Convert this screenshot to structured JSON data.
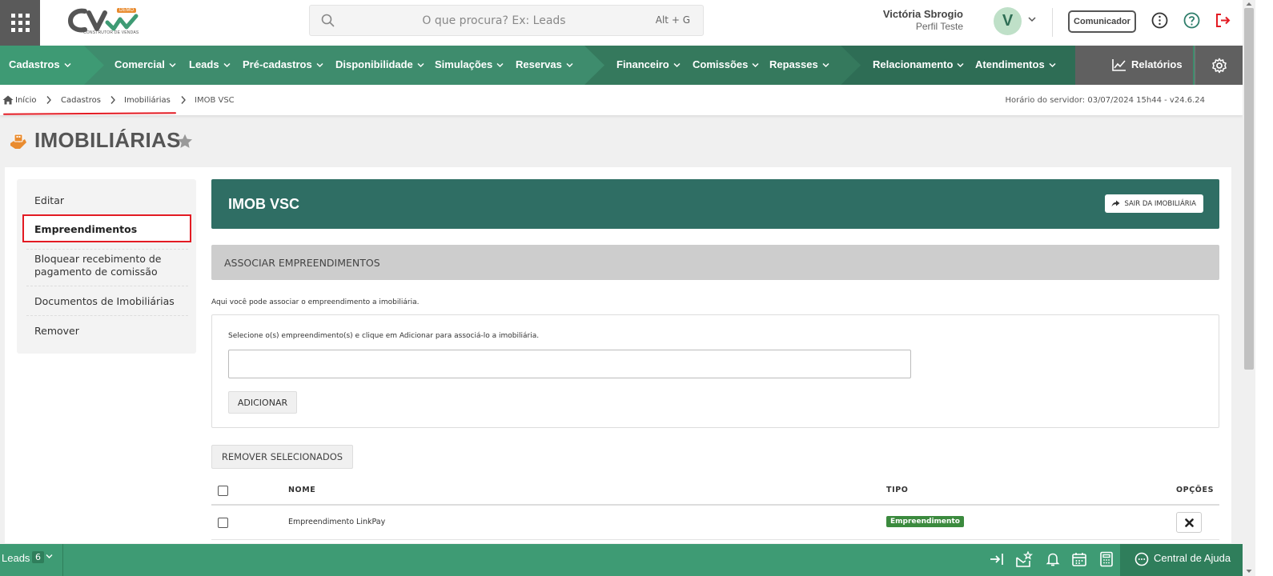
{
  "header": {
    "logo_text": "CV",
    "logo_badge": "DEMO",
    "logo_tagline": "CONSTRUTOR DE VENDAS",
    "search_placeholder": "O que procura? Ex: Leads",
    "search_shortcut": "Alt + G",
    "user_name": "Victória Sbrogio",
    "user_profile": "Perfil Teste",
    "avatar_letter": "V",
    "comunicador_label": "Comunicador",
    "icons": [
      "apps-grid-icon",
      "search-icon",
      "chevron-down-icon",
      "info-icon",
      "help-icon",
      "logout-icon"
    ]
  },
  "nav": {
    "items": [
      {
        "label": "Cadastros"
      },
      {
        "label": "Comercial"
      },
      {
        "label": "Leads"
      },
      {
        "label": "Pré-cadastros"
      },
      {
        "label": "Disponibilidade"
      },
      {
        "label": "Simulações"
      },
      {
        "label": "Reservas"
      },
      {
        "label": "Financeiro"
      },
      {
        "label": "Comissões"
      },
      {
        "label": "Repasses"
      },
      {
        "label": "Relacionamento"
      },
      {
        "label": "Atendimentos"
      }
    ],
    "relatorios_label": "Relatórios",
    "colors": {
      "base": "#3e8c6d",
      "seg_light": "#4aa07e",
      "seg_mid": "#3a8063",
      "seg_dark": "#2e6d55",
      "gray": "#606060"
    }
  },
  "breadcrumb": {
    "items": [
      "Início",
      "Cadastros",
      "Imobiliárias",
      "IMOB VSC"
    ],
    "server_time": "Horário do servidor: 03/07/2024 15h44 - v24.6.24"
  },
  "page": {
    "title": "IMOBILIÁRIAS"
  },
  "sidemenu": {
    "items": [
      {
        "label": "Editar"
      },
      {
        "label": "Empreendimentos"
      },
      {
        "label": "Bloquear recebimento de"
      },
      {
        "label": "pagamento de comissão"
      },
      {
        "label": "Documentos de Imobiliárias"
      },
      {
        "label": "Remover"
      }
    ]
  },
  "main": {
    "imob_name": "IMOB VSC",
    "sair_label": "SAIR DA IMOBILIÁRIA",
    "assoc_title": "ASSOCIAR EMPREENDIMENTOS",
    "assoc_desc": "Aqui você pode associar o empreendimento a imobiliária.",
    "select_label": "Selecione o(s) empreendimento(s) e clique em Adicionar para associá-lo a imobiliária.",
    "select_value": "",
    "add_label": "ADICIONAR",
    "remove_selected_label": "REMOVER SELECIONADOS",
    "table": {
      "columns": [
        "NOME",
        "TIPO",
        "OPÇÕES"
      ],
      "rows": [
        {
          "nome": "Empreendimento LinkPay",
          "tipo": "Empreendimento"
        }
      ]
    },
    "colors": {
      "header": "#2f6e64",
      "badge": "#3b8a3e",
      "highlight": "#e31b23"
    }
  },
  "bottombar": {
    "leads_label": "Leads",
    "leads_count": "6",
    "help_label": "Central de Ajuda",
    "icons": [
      "collapse-right-icon",
      "mail-star-icon",
      "bell-icon",
      "calendar-icon",
      "calculator-icon",
      "chat-icon"
    ]
  }
}
